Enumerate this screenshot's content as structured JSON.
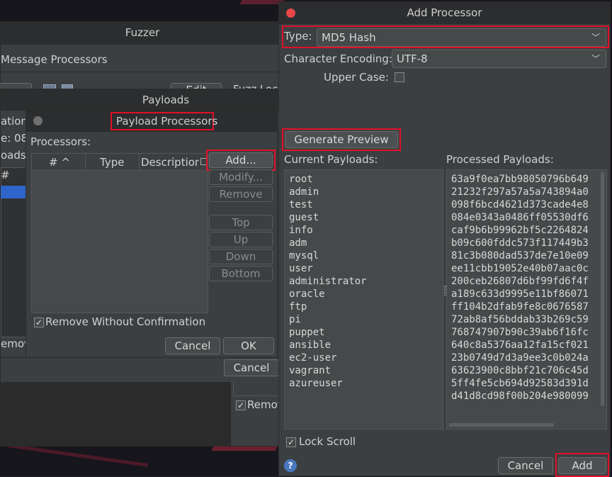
{
  "fuzzer": {
    "title": "Fuzzer",
    "message_processors": "Message Processors",
    "edit_label": "Edit",
    "fuzz_loc_label": "Fuzz Loc",
    "cancel_label": "Cancel",
    "remove_partial": "emov",
    "remove_partial2": "Remov"
  },
  "payloads": {
    "title": "Payloads",
    "side_label_1": "ation:",
    "side_label_2": "e: 08",
    "side_label_3": "oads:",
    "side_hash": "#"
  },
  "payload_processors": {
    "title": "Payload Processors",
    "processors_label": "Processors:",
    "columns": [
      "# ^",
      "Type",
      "Description"
    ],
    "buttons": {
      "add": "Add...",
      "modify": "Modify...",
      "remove": "Remove",
      "top": "Top",
      "up": "Up",
      "down": "Down",
      "bottom": "Bottom"
    },
    "remove_without_confirmation": "Remove Without Confirmation",
    "cancel": "Cancel",
    "ok": "OK"
  },
  "add_processor": {
    "title": "Add Processor",
    "type_label": "Type:",
    "type_value": "MD5 Hash",
    "encoding_label": "Character Encoding:",
    "encoding_value": "UTF-8",
    "upper_case_label": "Upper Case:",
    "generate_preview": "Generate Preview",
    "current_payloads_label": "Current Payloads:",
    "processed_payloads_label": "Processed Payloads:",
    "current_payloads": [
      "root",
      "admin",
      "test",
      "guest",
      "info",
      "adm",
      "mysql",
      "user",
      "administrator",
      "oracle",
      "ftp",
      "pi",
      "puppet",
      "ansible",
      "ec2-user",
      "vagrant",
      "azureuser"
    ],
    "processed_payloads": [
      "63a9f0ea7bb98050796b649",
      "21232f297a57a5a743894a0",
      "098f6bcd4621d373cade4e8",
      "084e0343a0486ff05530df6",
      "caf9b6b99962bf5c2264824",
      "b09c600fddc573f117449b3",
      "81c3b080dad537de7e10e09",
      "ee11cbb19052e40b07aac0c",
      "200ceb26807d6bf99fd6f4f",
      "a189c633d9995e11bf86071",
      "ff104b2dfab9fe8c0676587",
      "72ab8af56bddab33b269c59",
      "768747907b90c39ab6f16fc",
      "640c8a5376aa12fa15cf021",
      "23b0749d7d3a9ee3c0b024a",
      "63623900c8bbf21c706c45d",
      "5ff4fe5cb694d92583d391d",
      "d41d8cd98f00b204e980099"
    ],
    "lock_scroll": "Lock Scroll",
    "help": "?",
    "cancel": "Cancel",
    "add": "Add"
  },
  "colors": {
    "highlight_red": "#e0102a",
    "window_bg": "#3c3f41",
    "close_dot": "#e8474a"
  }
}
